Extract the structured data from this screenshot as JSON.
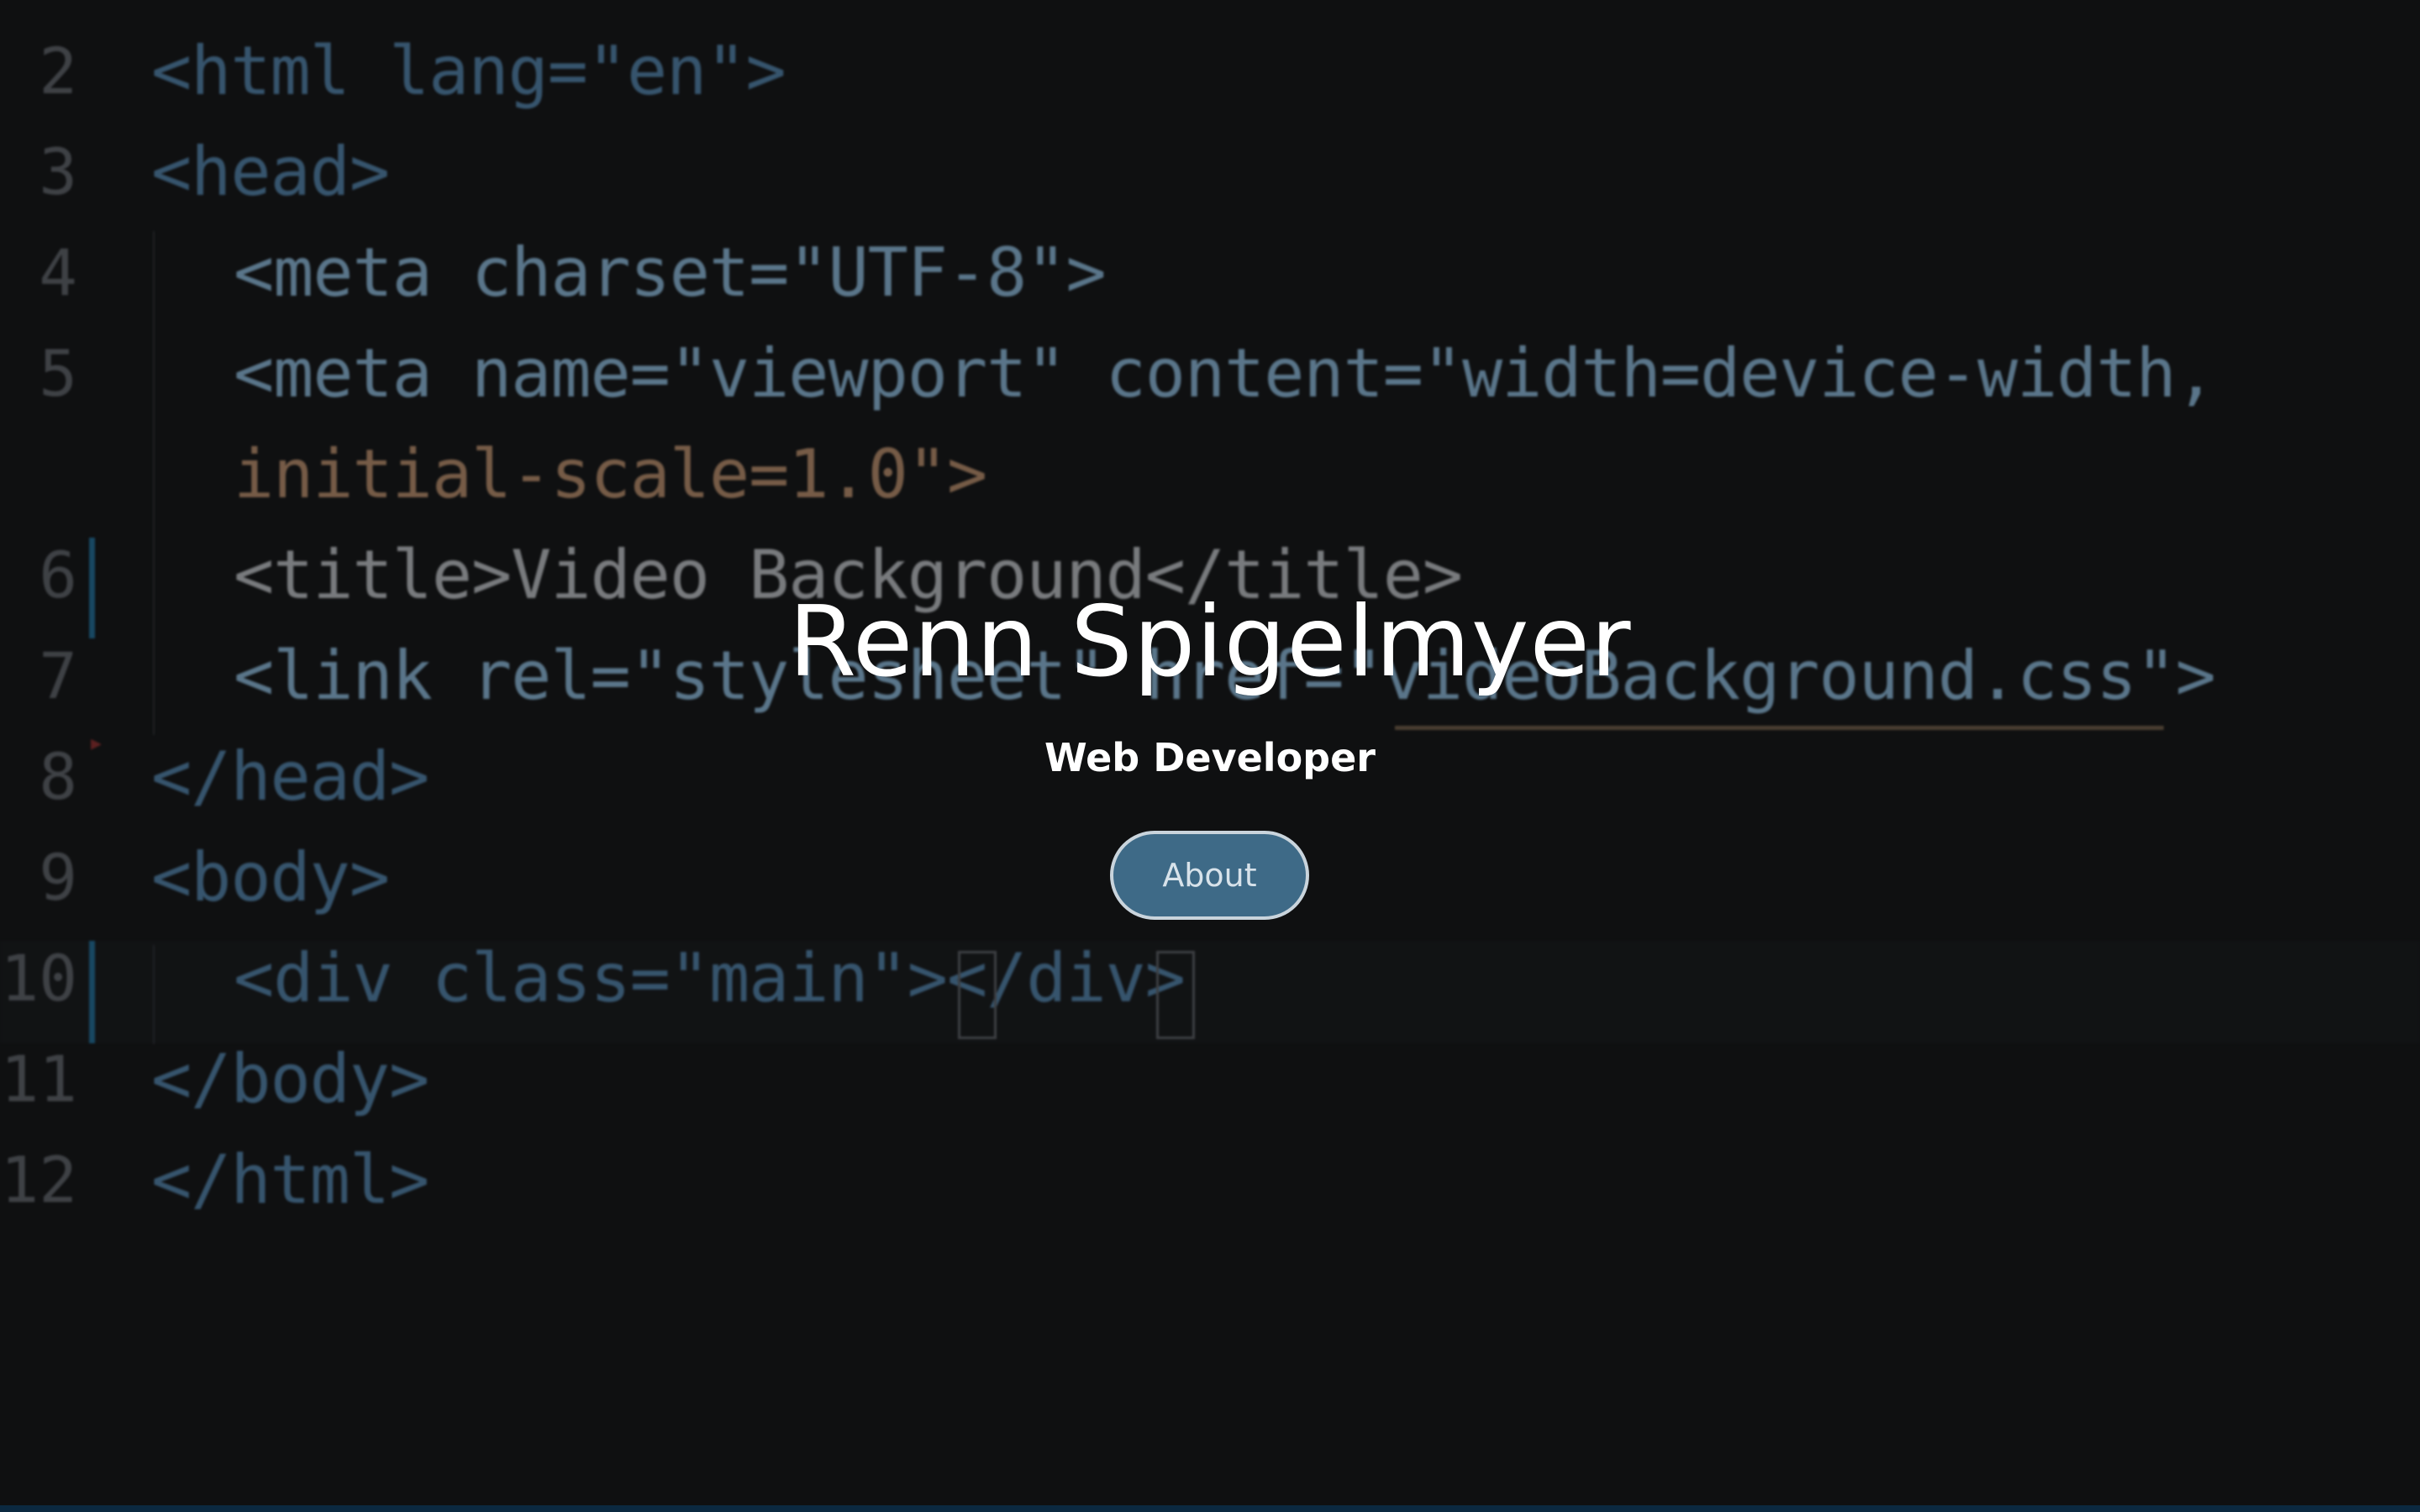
{
  "colors": {
    "background": "#0f1011",
    "button_fill": "#3e6a87",
    "button_border": "#c9d4dc",
    "text": "#ffffff",
    "gutter_accent": "#1e6a94"
  },
  "background_code": {
    "line_numbers": [
      "2",
      "3",
      "4",
      "5",
      "6",
      "7",
      "8",
      "9",
      "10",
      "11",
      "12"
    ],
    "lines": [
      "<html lang=\"en\">",
      "<head>",
      "<meta charset=\"UTF-8\">",
      "<meta name=\"viewport\" content=\"width=device-width,",
      "initial-scale=1.0\">",
      "<title>Video Background</title>",
      "<link rel=\"stylesheet\" href=\"videoBackground.css\">",
      "</head>",
      "<body>",
      "<div class=\"main\"></div>",
      "</body>",
      "</html>"
    ]
  },
  "hero": {
    "name": "Renn Spigelmyer",
    "role": "Web Developer",
    "about_label": "About"
  }
}
